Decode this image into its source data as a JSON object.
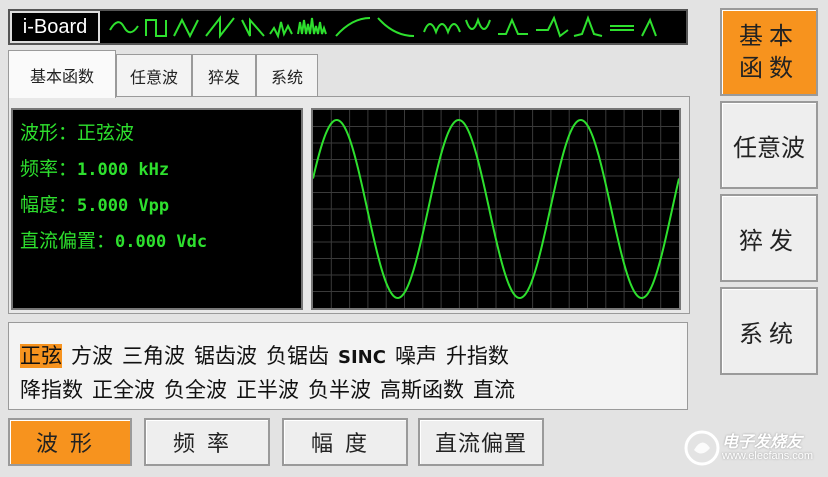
{
  "header": {
    "logo": "i-Board"
  },
  "tabs": [
    {
      "label": "基本函数",
      "active": true
    },
    {
      "label": "任意波",
      "active": false
    },
    {
      "label": "猝发",
      "active": false
    },
    {
      "label": "系统",
      "active": false
    }
  ],
  "info": {
    "waveform_label": "波形：",
    "waveform_value": "正弦波",
    "frequency_label": "频率：",
    "frequency_value": "1.000 kHz",
    "amplitude_label": "幅度：",
    "amplitude_value": "5.000 Vpp",
    "offset_label": "直流偏置：",
    "offset_value": "0.000 Vdc"
  },
  "scope": {
    "cycles": 3,
    "trace_color": "#2ee02e",
    "grid_color": "#3a3a3a"
  },
  "wave_list": {
    "row1": [
      "正弦",
      "方波",
      "三角波",
      "锯齿波",
      "负锯齿",
      "SINC",
      "噪声",
      "升指数"
    ],
    "row2": [
      "降指数",
      "正全波",
      "负全波",
      "正半波",
      "负半波",
      "高斯函数",
      "直流"
    ],
    "selected": "正弦"
  },
  "side_buttons": {
    "basic_line1": "基本",
    "basic_line2": "函数",
    "arbitrary": "任意波",
    "burst": "猝发",
    "system": "系统"
  },
  "bottom_buttons": {
    "waveform": "波形",
    "frequency": "频率",
    "amplitude": "幅度",
    "offset": "直流偏置"
  },
  "watermark": {
    "text": "电子发烧友",
    "url": "www.elecfans.com"
  },
  "colors": {
    "accent": "#f7931e",
    "screen_bg": "#000000",
    "screen_text": "#2ee02e"
  }
}
